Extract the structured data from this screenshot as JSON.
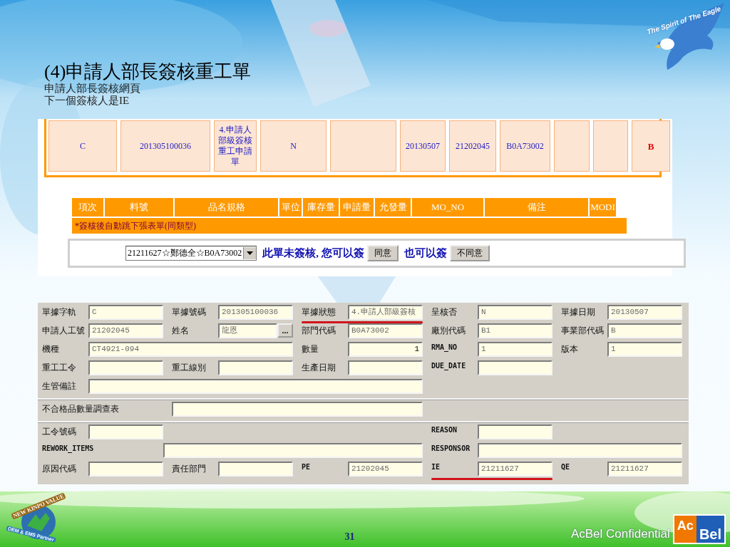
{
  "slide": {
    "title": "(4)申請人部長簽核重工單",
    "subtitle_lines": [
      "申請人部長簽核網頁",
      "下一個簽核人是IE"
    ],
    "eagle_logo_text": "The Spirit of The Eagle",
    "page_number": "31",
    "confidential": "AcBel Confidential",
    "acbel_logo": [
      "Ac",
      "Bel"
    ],
    "kinpo_logo": {
      "top": "NEW KINPO VALUE",
      "bottom": "OEM & EMS Partner"
    }
  },
  "web_form": {
    "record_cells": [
      {
        "kind": "text",
        "text": "C"
      },
      {
        "kind": "text",
        "text": "201305100036"
      },
      {
        "kind": "status",
        "text": "4.申請人部級簽核重工申請單"
      },
      {
        "kind": "text",
        "text": "N"
      },
      {
        "kind": "empty"
      },
      {
        "kind": "text",
        "text": "20130507"
      },
      {
        "kind": "text",
        "text": "21202045"
      },
      {
        "kind": "text",
        "text": "B0A73002"
      },
      {
        "kind": "empty"
      },
      {
        "kind": "empty"
      },
      {
        "kind": "flag",
        "text": "B"
      }
    ],
    "item_columns": [
      "項次",
      "料號",
      "品名規格",
      "單位",
      "庫存量",
      "申請量",
      "允發量",
      "MO_NO",
      "備注",
      "MODI"
    ],
    "note": "*簽核後自動跳下張表單(同類型)",
    "signer_select": "21211627☆鄭德全☆B0A73002",
    "prompt": "此單未簽核, 您可以簽",
    "approve_button": "同意",
    "or_text": "也可以簽",
    "reject_button": "不同意"
  },
  "desktop_form": {
    "sections": [
      {
        "rows": [
          {
            "fields": [
              {
                "label": "單據字軌",
                "value": "C",
                "kind": "text",
                "marked": false
              },
              {
                "label": "單據號碼",
                "value": "201305100036",
                "kind": "text",
                "marked": false
              },
              {
                "label": "單據狀態",
                "value": "4.申請人部級簽核",
                "kind": "text",
                "marked": true
              },
              {
                "label": "呈核否",
                "value": "N",
                "kind": "text",
                "marked": false
              },
              {
                "label": "單據日期",
                "value": "20130507",
                "kind": "text",
                "marked": false
              }
            ]
          },
          {
            "fields": [
              {
                "label": "申請人工號",
                "value": "21202045",
                "kind": "text",
                "marked": false
              },
              {
                "label": "姓名",
                "value": "龍恩",
                "kind": "lookup",
                "button": "...",
                "marked": false
              },
              {
                "label": "部門代碼",
                "value": "B0A73002",
                "kind": "text",
                "marked": false
              },
              {
                "label": "廠別代碼",
                "value": "B1",
                "kind": "text",
                "marked": false
              },
              {
                "label": "事業部代碼",
                "value": "B",
                "kind": "text",
                "marked": false
              }
            ]
          },
          {
            "fields": [
              {
                "label": "機種",
                "value": "CT4921-094",
                "kind": "text",
                "marked": false
              },
              {
                "label": "數量",
                "value": "1",
                "kind": "number",
                "marked": false
              },
              {
                "label": "RMA_NO",
                "value": "1",
                "kind": "text",
                "marked": false
              },
              {
                "label": "版本",
                "value": "1",
                "kind": "text",
                "marked": false
              }
            ]
          },
          {
            "fields": [
              {
                "label": "重工工令",
                "kind": "text",
                "marked": false
              },
              {
                "label": "重工線別",
                "kind": "text",
                "marked": false
              },
              {
                "label": "生產日期",
                "kind": "text",
                "marked": false
              },
              {
                "label": "DUE_DATE",
                "kind": "text",
                "marked": false
              }
            ]
          },
          {
            "fields": [
              {
                "label": "生管備註",
                "kind": "text",
                "marked": false
              }
            ]
          }
        ]
      },
      {
        "rows": [
          {
            "fields": [
              {
                "label": "不合格品數量調查表",
                "kind": "text",
                "marked": false
              }
            ]
          }
        ]
      },
      {
        "rows": [
          {
            "fields": [
              {
                "label": "工令號碼",
                "kind": "text",
                "marked": false
              },
              {
                "label": "REASON",
                "kind": "text",
                "marked": false
              }
            ]
          },
          {
            "fields": [
              {
                "label": "REWORK_ITEMS",
                "kind": "text",
                "marked": false
              },
              {
                "label": "RESPONSOR",
                "kind": "text",
                "marked": false
              }
            ]
          },
          {
            "fields": [
              {
                "label": "原因代碼",
                "kind": "text",
                "marked": false
              },
              {
                "label": "責任部門",
                "kind": "text",
                "marked": false
              },
              {
                "label": "PE",
                "value": "21202045",
                "kind": "text",
                "marked": false
              },
              {
                "label": "IE",
                "value": "21211627",
                "kind": "text",
                "marked": true
              },
              {
                "label": "QE",
                "value": "21211627",
                "kind": "text",
                "marked": false
              }
            ]
          }
        ]
      }
    ]
  }
}
